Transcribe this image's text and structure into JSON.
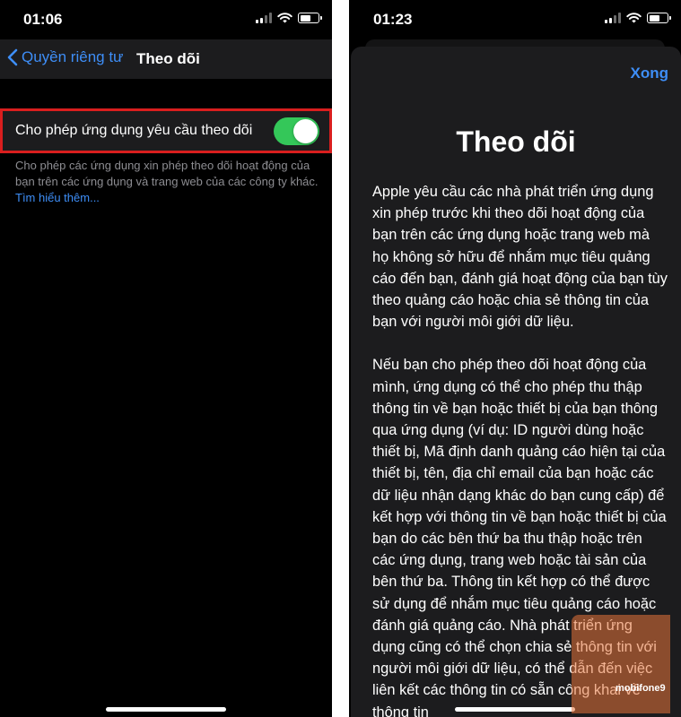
{
  "left_screen": {
    "status": {
      "time": "01:06"
    },
    "nav": {
      "back_label": "Quyền riêng tư",
      "title": "Theo dõi"
    },
    "row": {
      "label": "Cho phép ứng dụng yêu cầu theo dõi",
      "toggle_on": true
    },
    "footer": {
      "text": "Cho phép các ứng dụng xin phép theo dõi hoạt động của bạn trên các ứng dụng và trang web của các công ty khác. ",
      "link": "Tìm hiểu thêm..."
    }
  },
  "right_screen": {
    "status": {
      "time": "01:23"
    },
    "done_label": "Xong",
    "title": "Theo dõi",
    "paragraphs": [
      "Apple yêu cầu các nhà phát triển ứng dụng xin phép trước khi theo dõi hoạt động của bạn trên các ứng dụng hoặc trang web mà họ không sở hữu để nhắm mục tiêu quảng cáo đến bạn, đánh giá hoạt động của bạn tùy theo quảng cáo hoặc chia sẻ thông tin của bạn với người môi giới dữ liệu.",
      "Nếu bạn cho phép theo dõi hoạt động của mình, ứng dụng có thể cho phép thu thập thông tin về bạn hoặc thiết bị của bạn thông qua ứng dụng (ví dụ: ID người dùng hoặc thiết bị, Mã định danh quảng cáo hiện tại của thiết bị, tên, địa chỉ email của bạn hoặc các dữ liệu nhận dạng khác do bạn cung cấp) để kết hợp với thông tin về bạn hoặc thiết bị của bạn do các bên thứ ba thu thập hoặc trên các ứng dụng, trang web hoặc tài sản của bên thứ ba. Thông tin kết hợp có thể được sử dụng để nhắm mục tiêu quảng cáo hoặc đánh giá quảng cáo. Nhà phát triển ứng dụng cũng có thể chọn chia sẻ thông tin với người môi giới dữ liệu, có thể dẫn đến việc liên kết các thông tin có sẵn công khai về thông tin"
    ]
  },
  "watermark": {
    "text": "mobifone9"
  },
  "colors": {
    "accent": "#3e8ef7",
    "toggle_on": "#34c759",
    "highlight": "#d91e1e"
  }
}
